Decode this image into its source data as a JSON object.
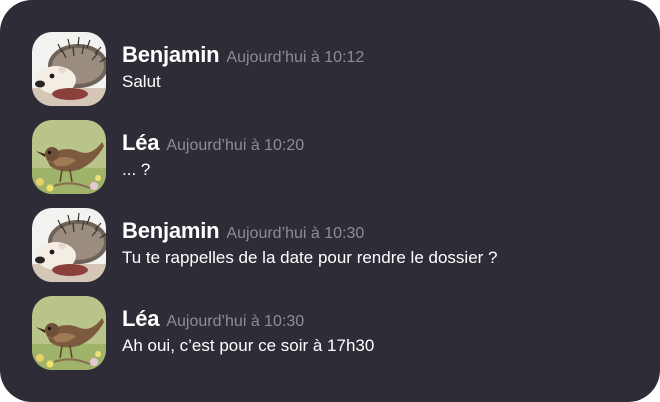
{
  "messages": [
    {
      "author": "Benjamin",
      "time": "Aujourd’hui à 10:12",
      "text": "Salut",
      "avatar": "hedgehog-avatar"
    },
    {
      "author": "Léa",
      "time": "Aujourd’hui à 10:20",
      "text": "... ?",
      "avatar": "bird-avatar"
    },
    {
      "author": "Benjamin",
      "time": "Aujourd’hui à 10:30",
      "text": "Tu te rappelles de la date pour rendre le dossier ?",
      "avatar": "hedgehog-avatar"
    },
    {
      "author": "Léa",
      "time": "Aujourd’hui à 10:30",
      "text": "Ah oui, c’est pour ce soir à 17h30",
      "avatar": "bird-avatar"
    }
  ],
  "colors": {
    "background": "#2e2d37",
    "author": "#ffffff",
    "timestamp": "#8c8b96",
    "text": "#ffffff"
  }
}
